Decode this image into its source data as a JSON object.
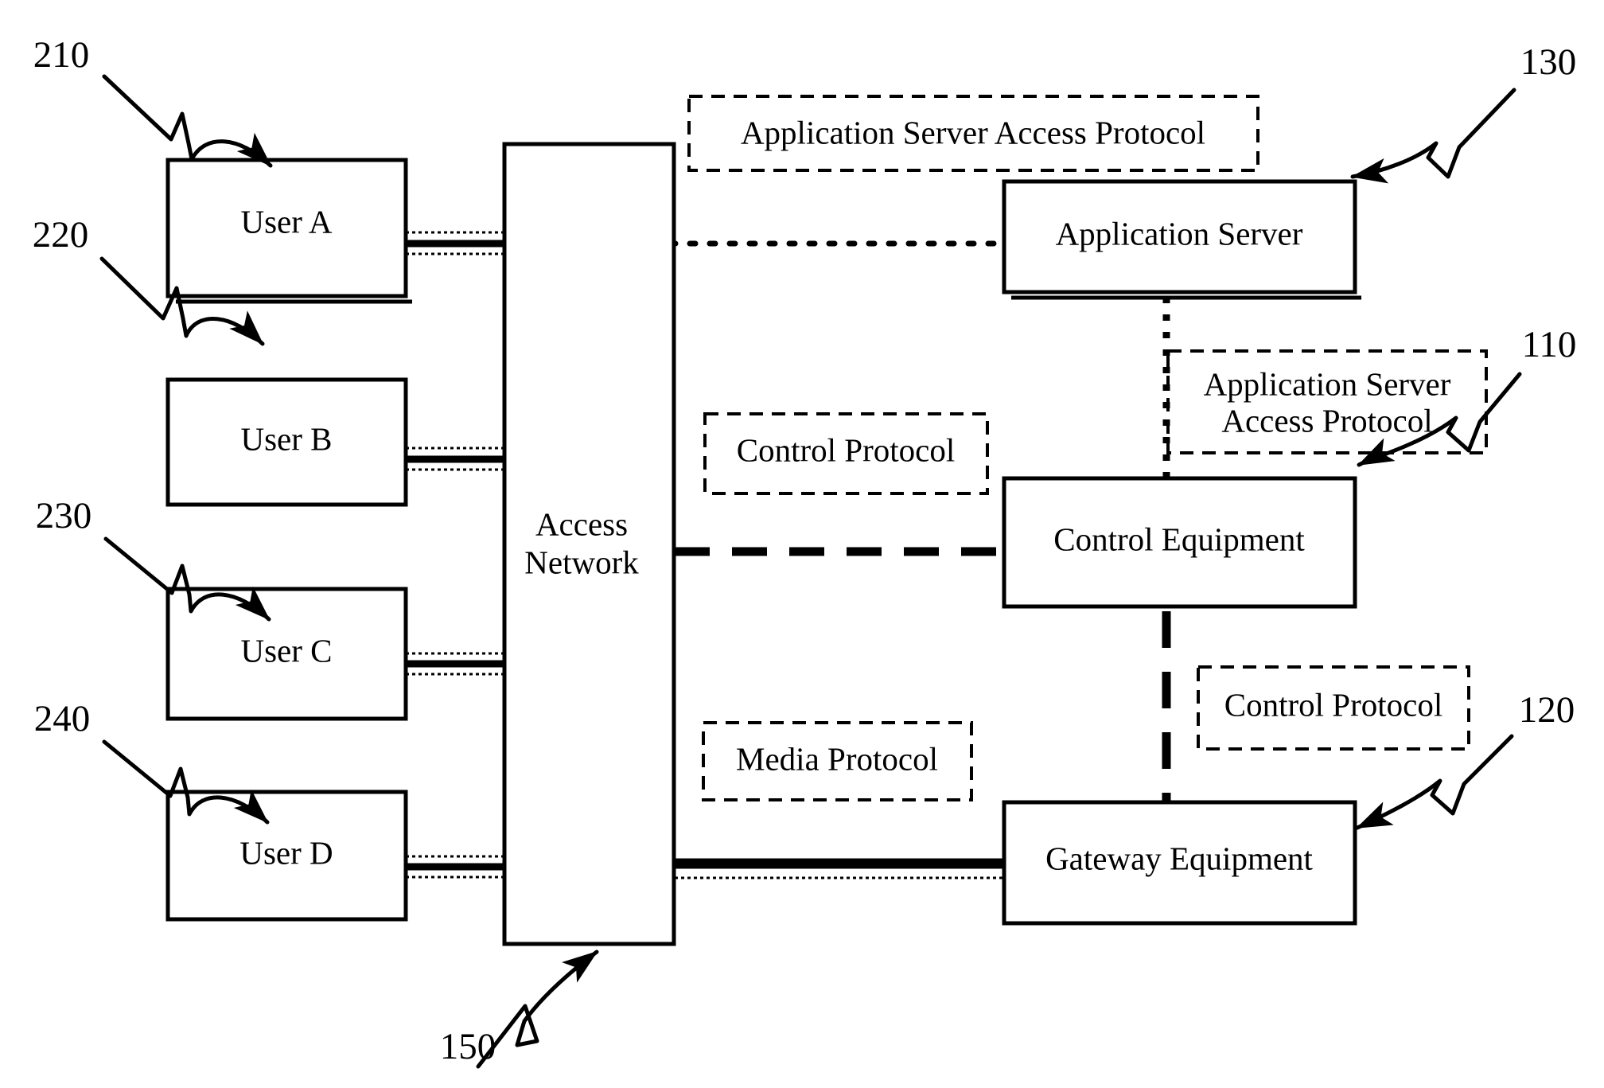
{
  "figure": {
    "type": "patent-block-diagram",
    "background_color": "#ffffff",
    "line_color": "#000000"
  },
  "nodes": {
    "user_a": {
      "label": "User A"
    },
    "user_b": {
      "label": "User B"
    },
    "user_c": {
      "label": "User C"
    },
    "user_d": {
      "label": "User D"
    },
    "access_network": {
      "label_line1": "Access",
      "label_line2": "Network"
    },
    "application_server": {
      "label": "Application Server"
    },
    "control_equipment": {
      "label": "Control Equipment"
    },
    "gateway_equipment": {
      "label": "Gateway Equipment"
    }
  },
  "protocol_labels": {
    "as_access_top": {
      "text": "Application Server Access Protocol"
    },
    "as_access_right_line1": {
      "text": "Application Server"
    },
    "as_access_right_line2": {
      "text": "Access Protocol"
    },
    "control_left": {
      "text": "Control Protocol"
    },
    "control_right": {
      "text": "Control Protocol"
    },
    "media": {
      "text": "Media Protocol"
    }
  },
  "reference_numerals": {
    "user_a": "210",
    "user_b": "220",
    "user_c": "230",
    "user_d": "240",
    "access_network": "150",
    "application_server": "130",
    "control_equipment": "110",
    "gateway_equipment": "120"
  }
}
